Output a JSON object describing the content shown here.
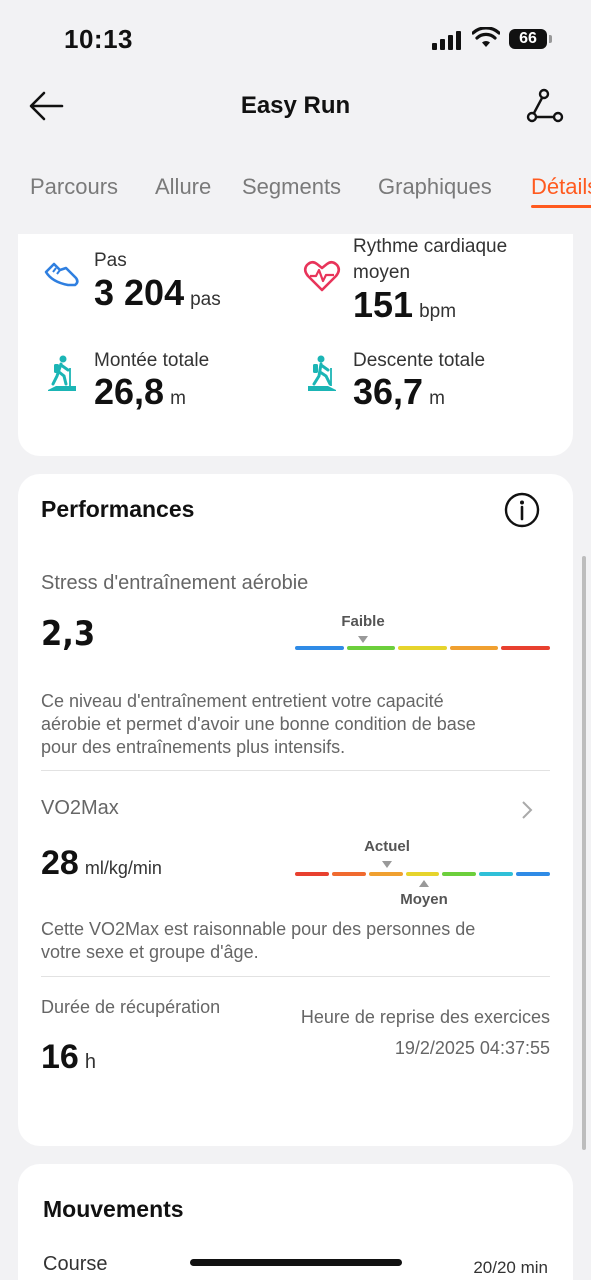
{
  "status_bar": {
    "time": "10:13",
    "battery": "66"
  },
  "header": {
    "title": "Easy Run"
  },
  "tabs": [
    "Parcours",
    "Allure",
    "Segments",
    "Graphiques",
    "Détails"
  ],
  "stats": {
    "steps": {
      "label": "Pas",
      "value": "3 204",
      "unit": "pas"
    },
    "heart_rate": {
      "label_line1": "Rythme cardiaque",
      "label_line2": "moyen",
      "value": "151",
      "unit": "bpm"
    },
    "ascent": {
      "label": "Montée totale",
      "value": "26,8",
      "unit": "m"
    },
    "descent": {
      "label": "Descente totale",
      "value": "36,7",
      "unit": "m"
    }
  },
  "performances": {
    "title": "Performances",
    "aerobic": {
      "label": "Stress d'entraînement aérobie",
      "value": "2,3",
      "gauge_label": "Faible",
      "description_lines": [
        "Ce niveau d'entraînement entretient votre capacité",
        "aérobie et permet d'avoir une bonne condition de base",
        "pour des entraînements plus intensifs."
      ],
      "colors": [
        "#2f8be6",
        "#6ccf3c",
        "#e6d42c",
        "#f0a030",
        "#e8402f"
      ]
    },
    "vo2max": {
      "label": "VO2Max",
      "value": "28",
      "unit": "ml/kg/min",
      "current_label": "Actuel",
      "average_label": "Moyen",
      "description_lines": [
        "Cette VO2Max est raisonnable pour des personnes de",
        "votre sexe et groupe d'âge."
      ],
      "colors": [
        "#e8402f",
        "#f06a2f",
        "#f0a030",
        "#e6d42c",
        "#6ccf3c",
        "#2fc0d8",
        "#2f8be6"
      ]
    },
    "recovery": {
      "label": "Durée de récupération",
      "value": "16",
      "unit": "h",
      "resume_label": "Heure de reprise des exercices",
      "resume_time": "19/2/2025 04:37:55"
    }
  },
  "movements": {
    "title": "Mouvements",
    "row_label": "Course",
    "row_value": "20/20 min"
  }
}
